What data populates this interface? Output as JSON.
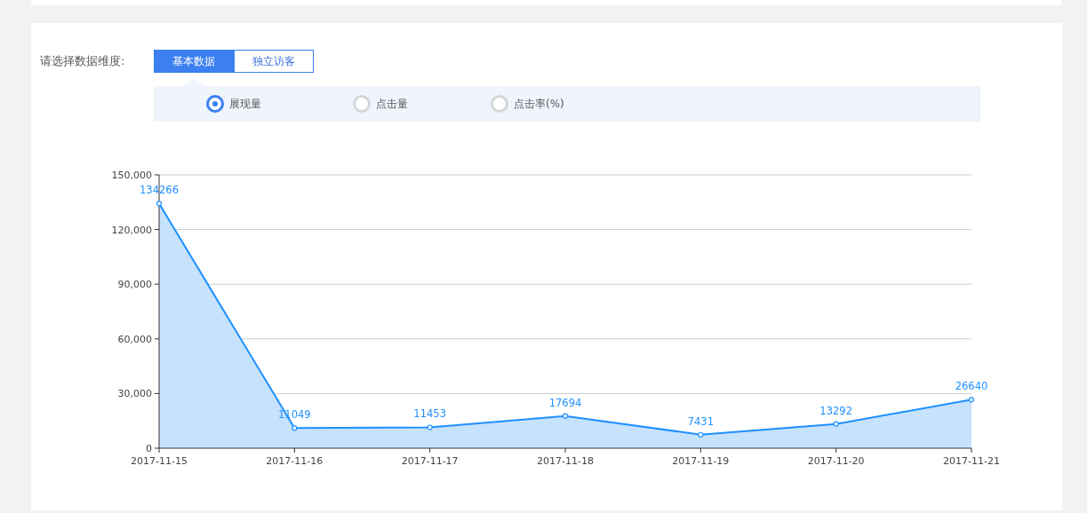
{
  "dimension_label": "请选择数据维度:",
  "tabs": [
    {
      "label": "基本数据",
      "selected": true
    },
    {
      "label": "独立访客",
      "selected": false
    }
  ],
  "metrics": [
    {
      "label": "展现量",
      "selected": true
    },
    {
      "label": "点击量",
      "selected": false
    },
    {
      "label": "点击率(%)",
      "selected": false
    }
  ],
  "chart_data": {
    "type": "area",
    "categories": [
      "2017-11-15",
      "2017-11-16",
      "2017-11-17",
      "2017-11-18",
      "2017-11-19",
      "2017-11-20",
      "2017-11-21"
    ],
    "grid": true,
    "series": [
      {
        "color": "#1e90ff",
        "values": [
          134266,
          11049,
          11453,
          17694,
          7431,
          13292,
          26640
        ]
      }
    ],
    "ylim": [
      0,
      150000
    ],
    "yticks": [
      {
        "value": 0,
        "label": "0"
      },
      {
        "value": 30000,
        "label": "30,000"
      },
      {
        "value": 60000,
        "label": "60,000"
      },
      {
        "value": 90000,
        "label": "90,000"
      },
      {
        "value": 120000,
        "label": "120,000"
      },
      {
        "value": 150000,
        "label": "150,000"
      }
    ],
    "data_labels": true
  }
}
